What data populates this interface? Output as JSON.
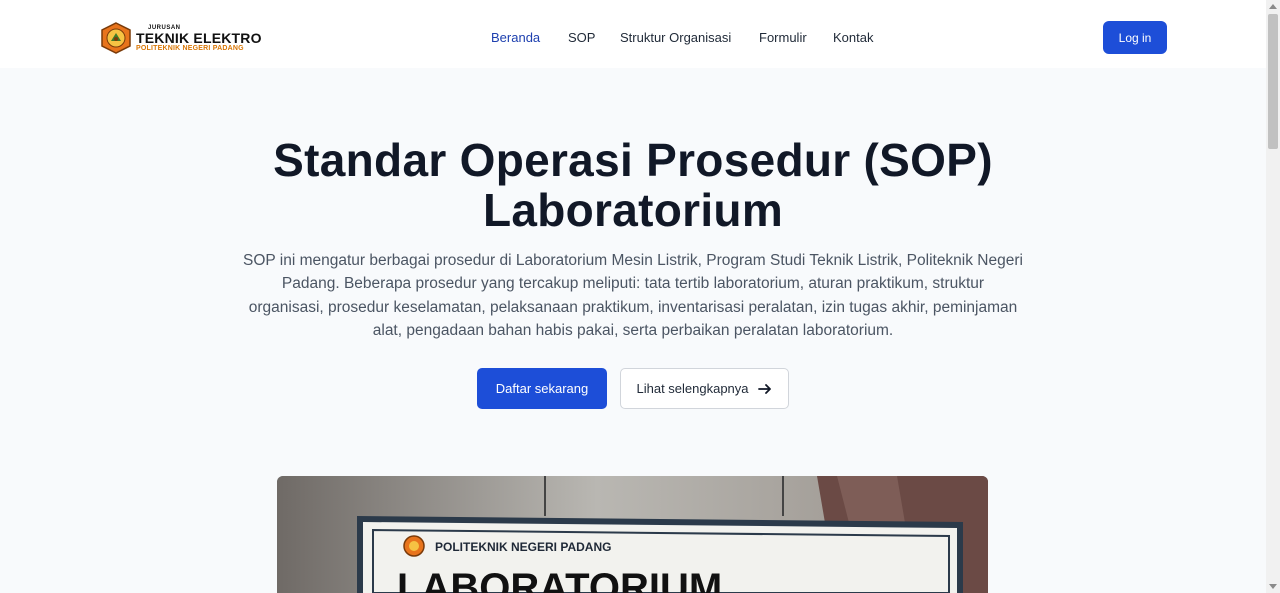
{
  "navbar": {
    "logo": {
      "small": "JURUSAN",
      "main": "TEKNIK ELEKTRO",
      "sub": "POLITEKNIK NEGERI PADANG"
    },
    "links": [
      {
        "label": "Beranda",
        "active": true
      },
      {
        "label": "SOP",
        "active": false
      },
      {
        "label": "Struktur Organisasi",
        "active": false
      },
      {
        "label": "Formulir",
        "active": false
      },
      {
        "label": "Kontak",
        "active": false
      }
    ],
    "login_label": "Log in"
  },
  "hero": {
    "title_line1": "Standar Operasi Prosedur (SOP)",
    "title_line2": "Laboratorium",
    "description": "SOP ini mengatur berbagai prosedur di Laboratorium Mesin Listrik, Program Studi Teknik Listrik, Politeknik Negeri Padang. Beberapa prosedur yang tercakup meliputi: tata tertib laboratorium, aturan praktikum, struktur organisasi, prosedur keselamatan, pelaksanaan praktikum, inventarisasi peralatan, izin tugas akhir, peminjaman alat, pengadaan bahan habis pakai, serta perbaikan peralatan laboratorium.",
    "primary_button": "Daftar sekarang",
    "secondary_button": "Lihat selengkapnya"
  },
  "photo": {
    "sign_text": "POLITEKNIK NEGERI PADANG",
    "sign_big": "LABORATORIUM"
  },
  "colors": {
    "accent": "#1d4ed8",
    "active_link": "#1e40af",
    "background": "#f8fafc"
  }
}
